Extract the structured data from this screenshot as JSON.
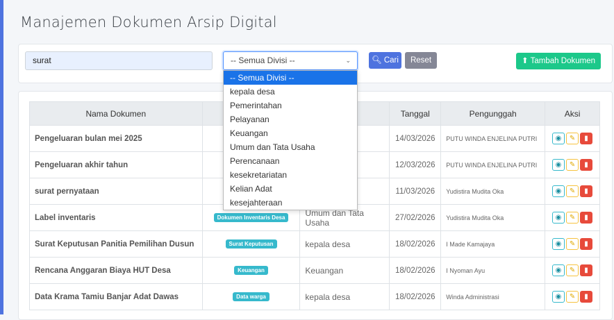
{
  "page": {
    "title": "Manajemen Dokumen Arsip Digital"
  },
  "filter": {
    "search_value": "surat",
    "division_selected": "-- Semua Divisi --",
    "search_button": "Cari",
    "reset_button": "Reset",
    "add_button": "Tambah Dokumen"
  },
  "dropdown_options": [
    "-- Semua Divisi --",
    "kepala desa",
    "Pemerintahan",
    "Pelayanan",
    "Keuangan",
    "Umum dan Tata Usaha",
    "Perencanaan",
    "kesekretariatan",
    "Kelian Adat",
    "kesejahteraan"
  ],
  "table": {
    "headers": {
      "name": "Nama Dokumen",
      "date": "Tanggal",
      "uploader": "Pengunggah",
      "actions": "Aksi"
    },
    "rows": [
      {
        "name": "Pengeluaran bulan mei 2025",
        "category": "",
        "division": "",
        "date": "14/03/2026",
        "uploader": "PUTU WINDA ENJELINA PUTRI"
      },
      {
        "name": "Pengeluaran akhir tahun",
        "category": "",
        "division": "",
        "date": "12/03/2026",
        "uploader": "PUTU WINDA ENJELINA PUTRI"
      },
      {
        "name": "surat pernyataan",
        "category": "",
        "division": "a Usaha",
        "date": "11/03/2026",
        "uploader": "Yudistira Mudita Oka"
      },
      {
        "name": "Label inventaris",
        "category": "Dokumen Inventaris Desa",
        "division": "Umum dan Tata Usaha",
        "date": "27/02/2026",
        "uploader": "Yudistira Mudita Oka"
      },
      {
        "name": "Surat Keputusan Panitia Pemilihan Dusun",
        "category": "Surat Keputusan",
        "division": "kepala desa",
        "date": "18/02/2026",
        "uploader": "I Made Kamajaya"
      },
      {
        "name": "Rencana Anggaran Biaya HUT Desa",
        "category": "Keuangan",
        "division": "Keuangan",
        "date": "18/02/2026",
        "uploader": "I Nyoman Ayu"
      },
      {
        "name": "Data Krama Tamiu Banjar Adat Dawas",
        "category": "Data warga",
        "division": "kepala desa",
        "date": "18/02/2026",
        "uploader": "Winda Administrasi"
      }
    ]
  },
  "icons": {
    "search": "search-icon",
    "upload": "upload-icon",
    "view": "eye-icon",
    "edit": "edit-icon",
    "delete": "trash-icon"
  },
  "colors": {
    "accent": "#4e73df",
    "success": "#1cc88a",
    "info": "#36b9cc",
    "danger": "#e74a3b"
  }
}
